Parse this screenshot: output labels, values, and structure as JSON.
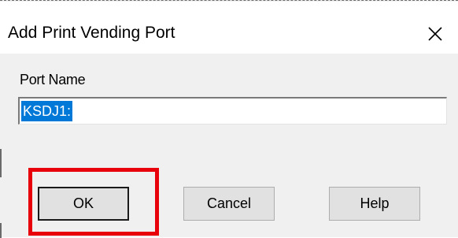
{
  "dialog": {
    "title": "Add Print Vending Port",
    "close_icon": "close-icon"
  },
  "form": {
    "port_name_label": "Port Name",
    "port_name_value": "KSDJ1:"
  },
  "buttons": {
    "ok_label": "OK",
    "cancel_label": "Cancel",
    "help_label": "Help"
  },
  "colors": {
    "selection": "#0078d7",
    "highlight": "#e8000b"
  }
}
